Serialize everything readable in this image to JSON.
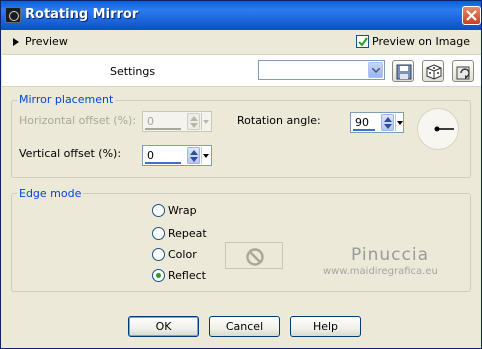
{
  "window": {
    "title": "Rotating Mirror"
  },
  "preview": {
    "label": "Preview",
    "checkbox_label": "Preview on Image",
    "checked": true
  },
  "settings": {
    "label": "Settings",
    "preset_value": ""
  },
  "mirror": {
    "group_title": "Mirror placement",
    "horizontal_label": "Horizontal offset (%):",
    "horizontal_value": "0",
    "vertical_label": "Vertical offset (%):",
    "vertical_value": "0",
    "rotation_label": "Rotation angle:",
    "rotation_value": "90"
  },
  "edge": {
    "group_title": "Edge mode",
    "options": [
      "Wrap",
      "Repeat",
      "Color",
      "Reflect"
    ],
    "selected": "Reflect"
  },
  "watermark": {
    "name": "Pinuccia",
    "url": "www.maidiregrafica.eu"
  },
  "buttons": {
    "ok": "OK",
    "cancel": "Cancel",
    "help": "Help"
  },
  "icons": {
    "title": "app-icon",
    "close": "close-icon",
    "preview_arrow": "triangle-right-icon",
    "save": "save-icon",
    "randomize": "dice-icon",
    "reset": "reset-icon",
    "no_color": "no-symbol-icon"
  }
}
